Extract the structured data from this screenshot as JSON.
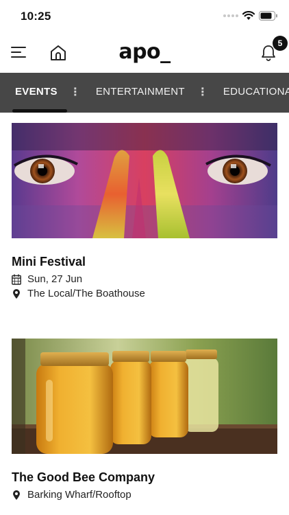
{
  "status_bar": {
    "time": "10:25"
  },
  "header": {
    "brand": "apo_",
    "notification_count": "5"
  },
  "tabs": [
    {
      "label": "EVENTS",
      "active": true
    },
    {
      "label": "ENTERTAINMENT",
      "active": false
    },
    {
      "label": "EDUCATIONAL",
      "active": false
    }
  ],
  "events": [
    {
      "title": "Mini Festival",
      "date": "Sun, 27 Jun",
      "location": "The Local/The Boathouse",
      "image": "face-paint-eyes-photo"
    },
    {
      "title": "The Good Bee Company",
      "location": "Barking Wharf/Rooftop",
      "image": "honey-jars-photo"
    }
  ],
  "colors": {
    "tab_bar": "#474747",
    "active_indicator": "#111111",
    "badge": "#111111"
  }
}
